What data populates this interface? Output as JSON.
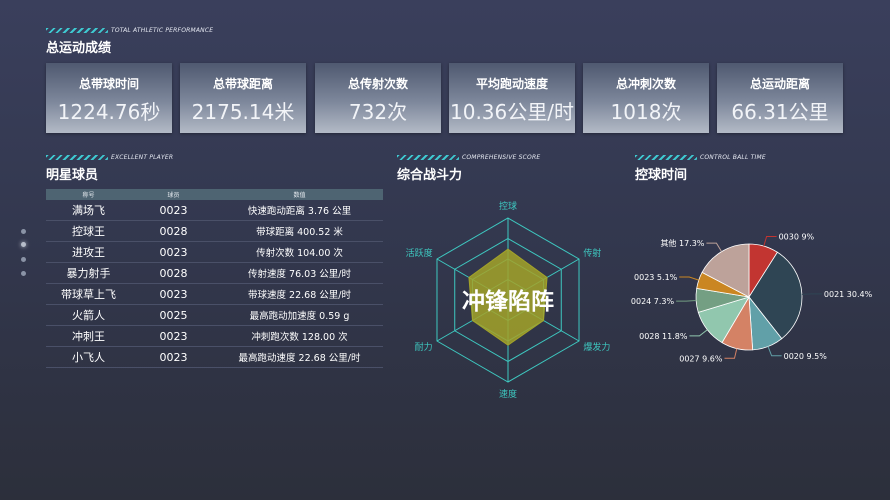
{
  "overview": {
    "subtitle": "TOTAL ATHLETIC PERFORMANCE",
    "title": "总运动成绩",
    "kpis": [
      {
        "label": "总带球时间",
        "value": "1224.76秒"
      },
      {
        "label": "总带球距离",
        "value": "2175.14米"
      },
      {
        "label": "总传射次数",
        "value": "732次"
      },
      {
        "label": "平均跑动速度",
        "value": "10.36公里/时"
      },
      {
        "label": "总冲刺次数",
        "value": "1018次"
      },
      {
        "label": "总运动距离",
        "value": "66.31公里"
      }
    ]
  },
  "players": {
    "subtitle": "EXCELLENT PLAYER",
    "title": "明星球员",
    "columns": [
      "称号",
      "球员",
      "数值"
    ],
    "rows": [
      {
        "title": "满场飞",
        "player": "0023",
        "stat": "快速跑动距离 3.76 公里"
      },
      {
        "title": "控球王",
        "player": "0028",
        "stat": "带球距离 400.52 米"
      },
      {
        "title": "进攻王",
        "player": "0023",
        "stat": "传射次数 104.00 次"
      },
      {
        "title": "暴力射手",
        "player": "0028",
        "stat": "传射速度 76.03 公里/时"
      },
      {
        "title": "带球草上飞",
        "player": "0023",
        "stat": "带球速度 22.68 公里/时"
      },
      {
        "title": "火箭人",
        "player": "0025",
        "stat": "最高跑动加速度 0.59 g"
      },
      {
        "title": "冲刺王",
        "player": "0023",
        "stat": "冲刺跑次数 128.00 次"
      },
      {
        "title": "小飞人",
        "player": "0023",
        "stat": "最高跑动速度 22.68 公里/时"
      }
    ]
  },
  "radar": {
    "subtitle": "COMPREHENSIVE SCORE",
    "title": "综合战斗力"
  },
  "pie": {
    "subtitle": "CONTROL BALL TIME",
    "title": "控球时间"
  },
  "chart_data": [
    {
      "type": "radar",
      "axes": [
        "控球",
        "传射",
        "爆发力",
        "速度",
        "耐力",
        "活跃度"
      ],
      "values": [
        0.62,
        0.55,
        0.5,
        0.55,
        0.5,
        0.55
      ],
      "max": 1,
      "rings": 4,
      "center_label": "冲锋陷阵",
      "colors": {
        "area": "#a3a329",
        "grid": "#3ec8c0",
        "label": "#3ec8c0"
      }
    },
    {
      "type": "pie",
      "slices": [
        {
          "label": "0030",
          "value": 9,
          "display": "0030 9%",
          "color": "#c23531"
        },
        {
          "label": "0021",
          "value": 30.4,
          "display": "0021 30.4%",
          "color": "#2f4554"
        },
        {
          "label": "0020",
          "value": 9.5,
          "display": "0020 9.5%",
          "color": "#61a0a8"
        },
        {
          "label": "0027",
          "value": 9.6,
          "display": "0027 9.6%",
          "color": "#d48265"
        },
        {
          "label": "0028",
          "value": 11.8,
          "display": "0028 11.8%",
          "color": "#91c7ae"
        },
        {
          "label": "0024",
          "value": 7.3,
          "display": "0024 7.3%",
          "color": "#749f83"
        },
        {
          "label": "0023",
          "value": 5.1,
          "display": "0023 5.1%",
          "color": "#ca8622"
        },
        {
          "label": "其他",
          "value": 17.3,
          "display": "其他 17.3%",
          "color": "#bda29a"
        }
      ]
    }
  ]
}
